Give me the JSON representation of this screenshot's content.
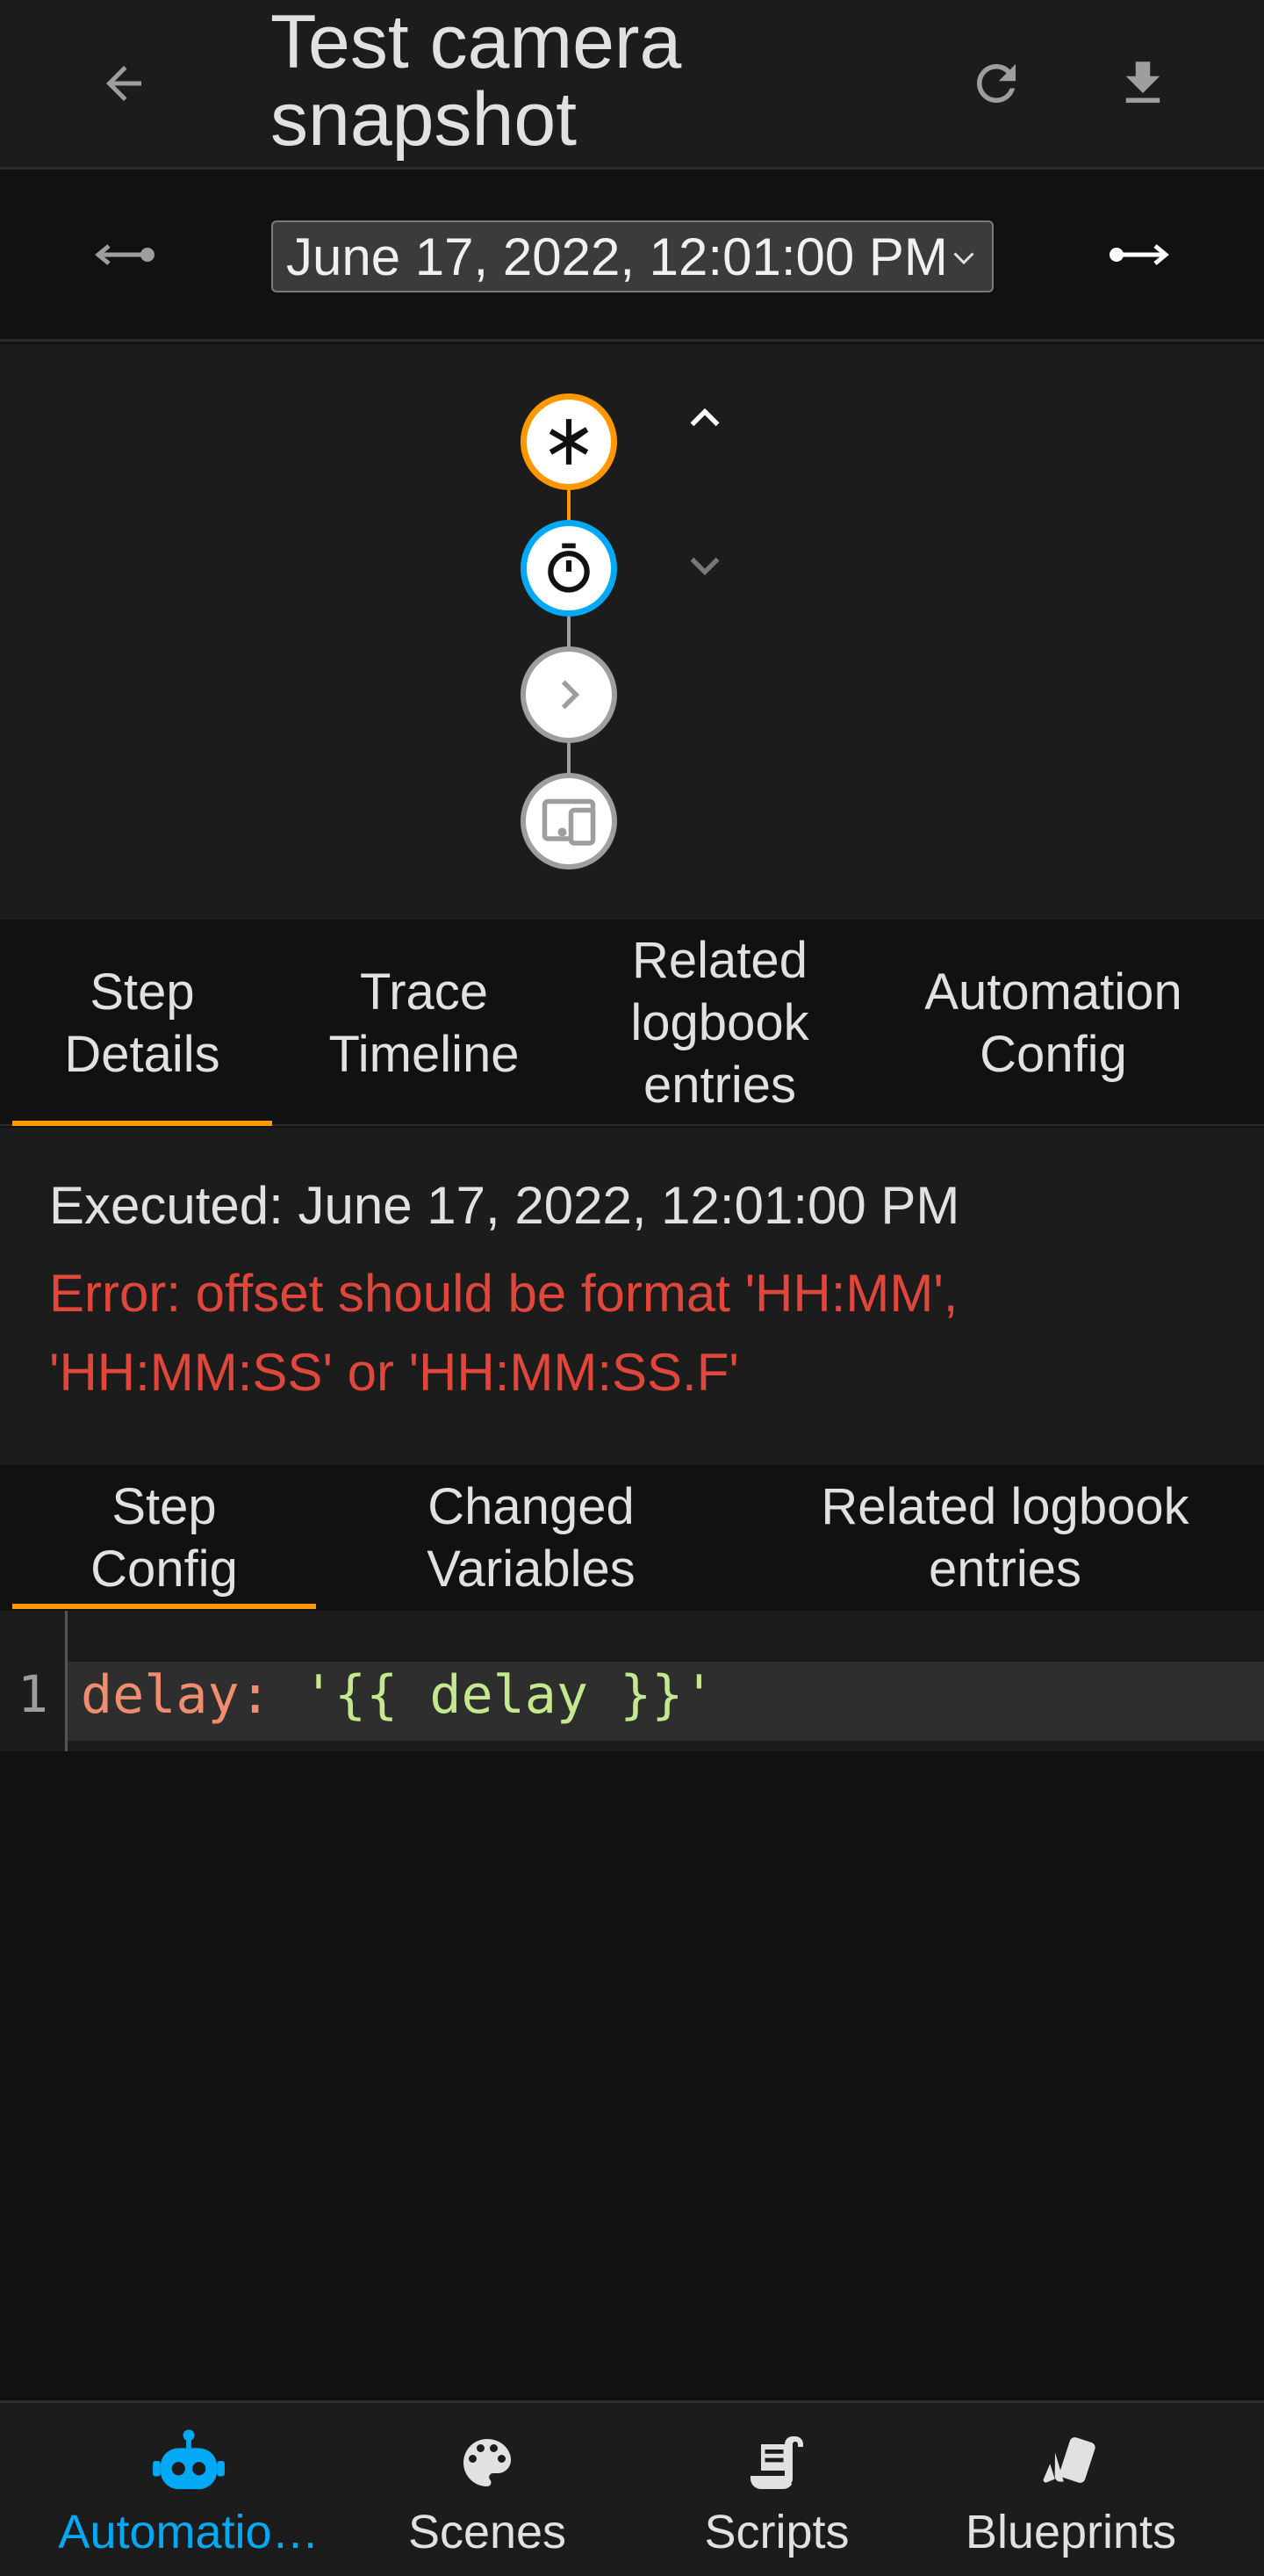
{
  "header": {
    "title": "Test camera snapshot"
  },
  "datebar": {
    "selected": "June 17, 2022, 12:01:00 PM"
  },
  "graph": {
    "nodes": [
      "trigger",
      "delay",
      "condition",
      "action"
    ],
    "colors": {
      "trigger": "#ff9800",
      "active": "#03a9f4",
      "inactive": "#9e9e9e"
    }
  },
  "tabs": [
    {
      "label": "Step Details",
      "active": true
    },
    {
      "label": "Trace Timeline"
    },
    {
      "label": "Related logbook entries"
    },
    {
      "label": "Automation Config"
    }
  ],
  "details": {
    "executed": "Executed: June 17, 2022, 12:01:00 PM",
    "error": "Error: offset should be format 'HH:MM', 'HH:MM:SS' or 'HH:MM:SS.F'"
  },
  "subtabs": [
    {
      "label": "Step Config",
      "active": true
    },
    {
      "label": "Changed Variables"
    },
    {
      "label": "Related logbook entries"
    }
  ],
  "code": {
    "line_number": "1",
    "key": "delay:",
    "value": "'{{ delay }}'"
  },
  "bottom_nav": [
    {
      "label": "Automatio…",
      "icon": "robot-icon",
      "active": true
    },
    {
      "label": "Scenes",
      "icon": "palette-icon"
    },
    {
      "label": "Scripts",
      "icon": "script-icon"
    },
    {
      "label": "Blueprints",
      "icon": "blueprint-icon"
    }
  ],
  "theme": {
    "accent": "#ff9800",
    "primary": "#03a9f4",
    "error": "#e0463a"
  }
}
